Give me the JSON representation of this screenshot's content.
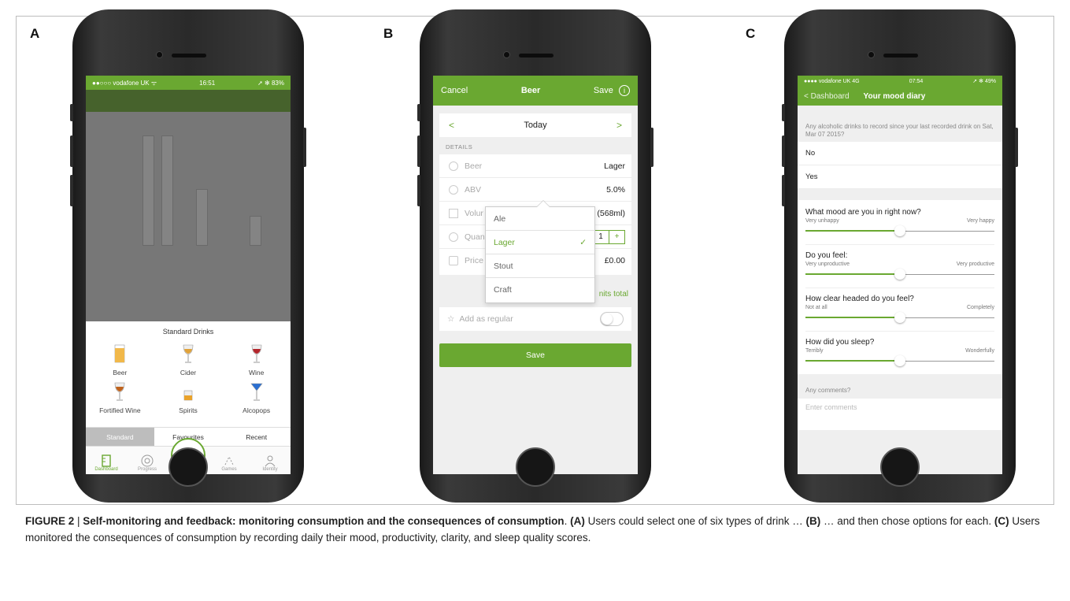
{
  "panels": {
    "a": "A",
    "b": "B",
    "c": "C"
  },
  "phone_a": {
    "status": {
      "carrier": "●●○○○ vodafone UK ᯤ",
      "time": "16:51",
      "battery": "➚ ✻ 83%"
    },
    "sheet_title": "Standard Drinks",
    "drinks": [
      {
        "label": "Beer",
        "icon": "beer-glass-icon",
        "color": "#f1b84a"
      },
      {
        "label": "Cider",
        "icon": "cider-glass-icon",
        "color": "#e0a23a"
      },
      {
        "label": "Wine",
        "icon": "wine-glass-icon",
        "color": "#b3262c"
      },
      {
        "label": "Fortified Wine",
        "icon": "fortified-wine-icon",
        "color": "#c0631c"
      },
      {
        "label": "Spirits",
        "icon": "spirits-glass-icon",
        "color": "#e9a22b"
      },
      {
        "label": "Alcopops",
        "icon": "alcopops-glass-icon",
        "color": "#2a6fd1"
      }
    ],
    "tabs": [
      "Standard",
      "Favourites",
      "Recent"
    ],
    "tabbar": [
      "Dashboard",
      "Progress",
      "",
      "Games",
      "Identity"
    ],
    "center_button": "✕"
  },
  "phone_b": {
    "nav": {
      "cancel": "Cancel",
      "title": "Beer",
      "save": "Save",
      "info": "i"
    },
    "date": "Today",
    "details_label": "DETAILS",
    "rows": [
      {
        "label": "Beer",
        "value": "Lager"
      },
      {
        "label": "ABV",
        "value": "5.0%"
      },
      {
        "label": "Volur",
        "value": ": (568ml)"
      },
      {
        "label": "Quan",
        "value": "1"
      },
      {
        "label": "Price",
        "value": "£0.00"
      }
    ],
    "units_total": "nits total",
    "regular_label": "Add as regular",
    "save_button": "Save",
    "popup_options": [
      {
        "label": "Ale",
        "check": ""
      },
      {
        "label": "Lager",
        "check": "✓"
      },
      {
        "label": "Stout",
        "check": ""
      },
      {
        "label": "Craft",
        "check": ""
      }
    ]
  },
  "phone_c": {
    "status": {
      "carrier": "●●●● vodafone UK 4G",
      "time": "07:54",
      "battery": "➚ ✻ 49%"
    },
    "nav": {
      "back": "< Dashboard",
      "title": "Your mood diary"
    },
    "question": "Any alcoholic drinks to record since your last recorded drink on Sat, Mar 07 2015?",
    "choices": [
      "No",
      "Yes"
    ],
    "sliders": [
      {
        "question": "What mood are you in right now?",
        "low": "Very unhappy",
        "high": "Very happy",
        "value": 0.5
      },
      {
        "question": "Do you feel:",
        "low": "Very unproductive",
        "high": "Very productive",
        "value": 0.5
      },
      {
        "question": "How clear headed do you feel?",
        "low": "Not at all",
        "high": "Completely",
        "value": 0.5
      },
      {
        "question": "How did you sleep?",
        "low": "Terribly",
        "high": "Wonderfully",
        "value": 0.5
      }
    ],
    "comments_label": "Any comments?",
    "comments_placeholder": "Enter comments"
  },
  "caption": {
    "figure": "FIGURE 2",
    "sep": " | ",
    "title": "Self-monitoring and feedback: monitoring consumption and the consequences of consumption",
    "a_label": "(A)",
    "a_text": " Users could select one of six types of drink … ",
    "b_label": "(B)",
    "b_text": " … and then chose options for each. ",
    "c_label": "(C)",
    "c_text": " Users monitored the consequences of consumption by recording daily their mood, productivity, clarity, and sleep quality scores."
  },
  "colors": {
    "accent": "#6aa831"
  }
}
